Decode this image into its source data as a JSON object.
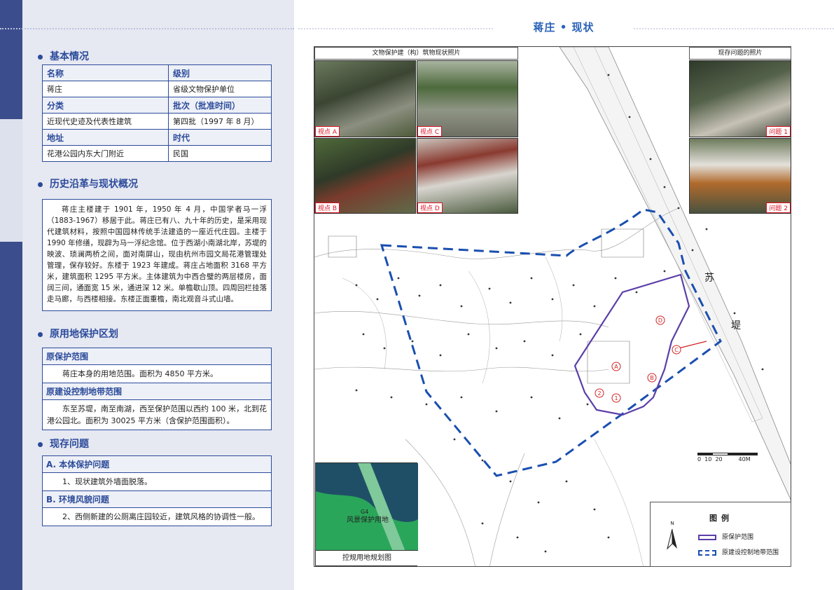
{
  "page": {
    "title": "蒋庄 • 现状"
  },
  "sections": {
    "basic": "基本情况",
    "history": "历史沿革与现状概况",
    "protection": "原用地保护区划",
    "problems": "现存问题"
  },
  "basic_table": {
    "rows": [
      {
        "k1": "名称",
        "k2": "级别",
        "header": true
      },
      {
        "k1": "蒋庄",
        "k2": "省级文物保护单位",
        "header": false
      },
      {
        "k1": "分类",
        "k2": "批次（批准时间）",
        "header": true
      },
      {
        "k1": "近现代史迹及代表性建筑",
        "k2": "第四批（1997 年 8 月）",
        "header": false
      },
      {
        "k1": "地址",
        "k2": "时代",
        "header": true
      },
      {
        "k1": "花港公园内东大门附近",
        "k2": "民国",
        "header": false
      }
    ]
  },
  "history_text": "蒋庄主楼建于 1901 年，1950 年 4 月，中国学者马一浮（1883-1967）移居于此。蒋庄已有八、九十年的历史，是采用现代建筑材料，按照中国园林传统手法建造的一座近代庄园。主楼于 1990 年修缮，现辟为马一浮纪念馆。位于西湖小南湖北岸，苏堤的映波、琐澜两桥之间，面对南屏山，现由杭州市园文局花港管理处管理，保存较好。东楼于 1923 年建成。蒋庄占地面积 3168 平方米，建筑面积 1295 平方米。主体建筑为中西合璧的两层楼房，面阔三间，通面宽 15 米，通进深 12 米。单檐歇山顶。四周回栏挂落走马廊，与西楼相接。东楼正面重檐，南北观音斗式山墙。",
  "protection": {
    "original_h": "原保护范围",
    "original_t": "蒋庄本身的用地范围。面积为 4850 平方米。",
    "control_h": "原建设控制地带范围",
    "control_t": "东至苏堤，南至南湖，西至保护范围以西约 100 米，北到花港公园北。面积为 30025 平方米（含保护范围面积）。"
  },
  "problems": {
    "a_h": "A. 本体保护问题",
    "a_t": "1、现状建筑外墙面脱落。",
    "b_h": "B. 环境风貌问题",
    "b_t": "2、西侧新建的公厕离庄园较近，建筑风格的协调性一般。"
  },
  "right": {
    "photo_caption": "文物保护建（构）筑物现状照片",
    "problem_caption": "现存问题的照片",
    "photos": [
      "视点 A",
      "视点 C",
      "视点 B",
      "视点 D"
    ],
    "problem_photos": [
      "问题 1",
      "问题 2"
    ],
    "map_su": "苏",
    "map_di": "堤",
    "inset_caption": "控规用地规划图",
    "inset_label": "风景保护用地",
    "inset_code": "G4",
    "legend_title": "图例",
    "legend_items": [
      "原保护范围",
      "原建设控制地带范围"
    ],
    "north": "N",
    "scale": "0  10  20         40M",
    "markers": [
      "A",
      "B",
      "C",
      "D",
      "1",
      "2"
    ]
  },
  "colors": {
    "accent": "#2b4b9a",
    "protect": "#5b3ea8",
    "control": "#1a4fb0",
    "marker": "#d12222"
  }
}
